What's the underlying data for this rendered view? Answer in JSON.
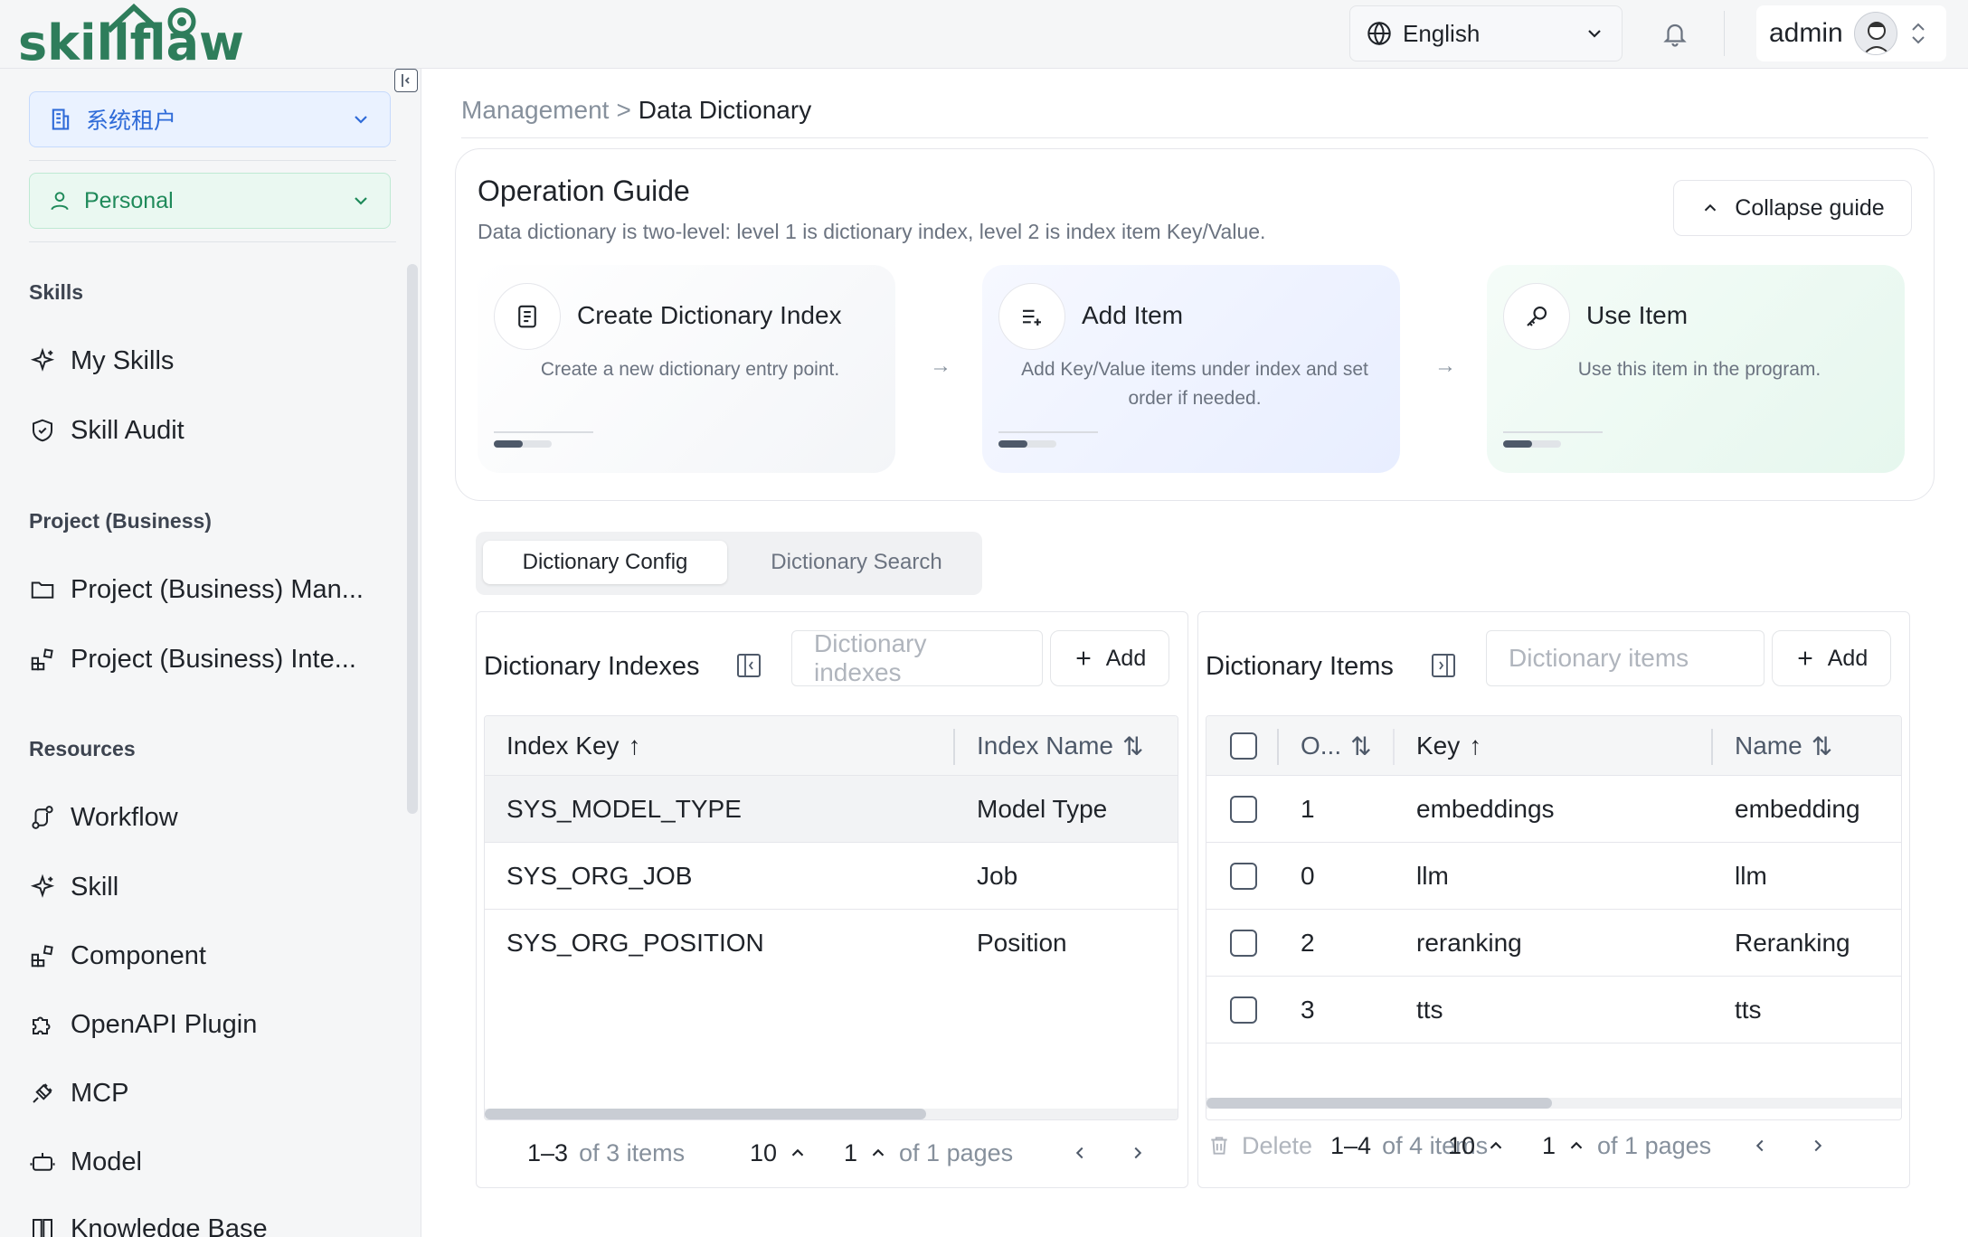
{
  "app": {
    "logo_text": "skillflaw",
    "language": "English",
    "user_name": "admin"
  },
  "sidebar": {
    "tenant": "系统租户",
    "workspace": "Personal",
    "sections": [
      {
        "title": "Skills",
        "items": [
          {
            "label": "My Skills",
            "icon": "sparkle-icon"
          },
          {
            "label": "Skill Audit",
            "icon": "shield-check-icon"
          }
        ]
      },
      {
        "title": "Project (Business)",
        "items": [
          {
            "label": "Project (Business) Man...",
            "icon": "folder-icon"
          },
          {
            "label": "Project (Business) Inte...",
            "icon": "blocks-icon"
          }
        ]
      },
      {
        "title": "Resources",
        "items": [
          {
            "label": "Workflow",
            "icon": "workflow-icon"
          },
          {
            "label": "Skill",
            "icon": "sparkle-icon"
          },
          {
            "label": "Component",
            "icon": "blocks-icon"
          },
          {
            "label": "OpenAPI Plugin",
            "icon": "puzzle-icon"
          },
          {
            "label": "MCP",
            "icon": "plug-icon"
          },
          {
            "label": "Model",
            "icon": "robot-icon"
          },
          {
            "label": "Knowledge Base",
            "icon": "book-icon"
          }
        ]
      }
    ]
  },
  "breadcrumb": {
    "parent": "Management",
    "separator": ">",
    "current": "Data Dictionary"
  },
  "guide": {
    "title": "Operation Guide",
    "subtitle": "Data dictionary is two-level: level 1 is dictionary index, level 2 is index item Key/Value.",
    "collapse_label": "Collapse guide",
    "steps": [
      {
        "title": "Create Dictionary Index",
        "desc": "Create a new dictionary entry point.",
        "icon": "document-icon",
        "progress": 0.5
      },
      {
        "title": "Add Item",
        "desc": "Add Key/Value items under index and set order if needed.",
        "icon": "list-plus-icon",
        "progress": 0.5
      },
      {
        "title": "Use Item",
        "desc": "Use this item in the program.",
        "icon": "key-icon",
        "progress": 0.5
      }
    ]
  },
  "tabs": [
    {
      "label": "Dictionary Config",
      "active": true
    },
    {
      "label": "Dictionary Search",
      "active": false
    }
  ],
  "indexes_panel": {
    "title": "Dictionary Indexes",
    "search_placeholder": "Dictionary indexes",
    "add_label": "Add",
    "columns": [
      {
        "label": "Index Key",
        "sort": "↑"
      },
      {
        "label": "Index Name",
        "sort": "⇅"
      }
    ],
    "rows": [
      {
        "key": "SYS_MODEL_TYPE",
        "name": "Model Type"
      },
      {
        "key": "SYS_ORG_JOB",
        "name": "Job"
      },
      {
        "key": "SYS_ORG_POSITION",
        "name": "Position"
      }
    ],
    "pager": {
      "range": "1–3",
      "of_items": "of 3 items",
      "page_size": "10",
      "page": "1",
      "of_pages": "of 1 pages"
    }
  },
  "items_panel": {
    "title": "Dictionary Items",
    "search_placeholder": "Dictionary items",
    "add_label": "Add",
    "columns": [
      {
        "label": "O...",
        "sort": "⇅"
      },
      {
        "label": "Key",
        "sort": "↑"
      },
      {
        "label": "Name",
        "sort": "⇅"
      }
    ],
    "rows": [
      {
        "order": "1",
        "key": "embeddings",
        "name": "embedding"
      },
      {
        "order": "0",
        "key": "llm",
        "name": "llm"
      },
      {
        "order": "2",
        "key": "reranking",
        "name": "Reranking"
      },
      {
        "order": "3",
        "key": "tts",
        "name": "tts"
      }
    ],
    "pager": {
      "delete_label": "Delete",
      "range": "1–4",
      "of_items": "of 4 items",
      "page_size": "10",
      "page": "1",
      "of_pages": "of 1 pages"
    }
  },
  "colors": {
    "accent_blue": "#2f6bd8",
    "accent_green": "#1f8a5a",
    "step1_bg": "#f5f7fa",
    "step2_bg": "#eef3ff",
    "step3_bg": "#eefaf4"
  }
}
